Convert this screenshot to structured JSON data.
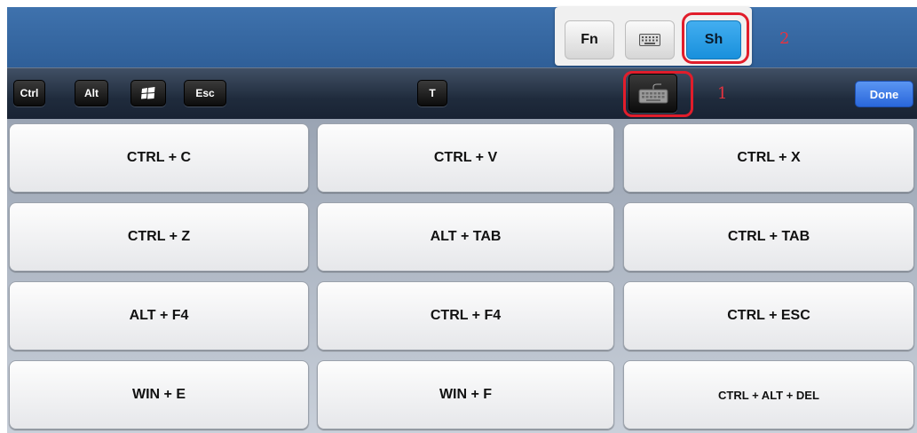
{
  "popover": {
    "fn_label": "Fn",
    "sh_label": "Sh",
    "keyboard_icon": "keyboard-icon"
  },
  "annotations": {
    "marker_1": "1",
    "marker_2": "2",
    "color": "#e11d2b"
  },
  "toolbar": {
    "ctrl_label": "Ctrl",
    "alt_label": "Alt",
    "win_icon": "windows-logo-icon",
    "esc_label": "Esc",
    "t_label": "T",
    "keyboard_toggle_icon": "keyboard-icon",
    "done_label": "Done"
  },
  "shortcuts": [
    [
      "CTRL + C",
      "CTRL + V",
      "CTRL + X"
    ],
    [
      "CTRL + Z",
      "ALT + TAB",
      "CTRL + TAB"
    ],
    [
      "ALT + F4",
      "CTRL + F4",
      "CTRL + ESC"
    ],
    [
      "WIN + E",
      "WIN + F",
      "CTRL + ALT + DEL"
    ]
  ],
  "colors": {
    "top_bar": "#3f72ad",
    "toolbar": "#1f2b3c",
    "active_sh": "#1990dc",
    "done": "#2a67db"
  }
}
